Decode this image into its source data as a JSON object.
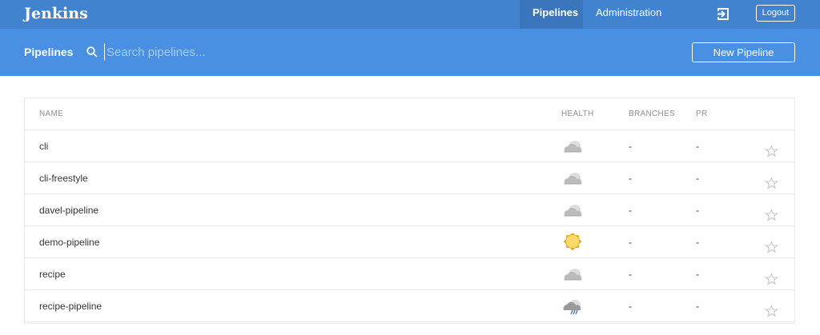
{
  "topbar": {
    "logo": "Jenkins",
    "nav": [
      {
        "label": "Pipelines",
        "active": true
      },
      {
        "label": "Administration",
        "active": false
      }
    ],
    "login_icon": "sign-in-icon",
    "logout_label": "Logout"
  },
  "subheader": {
    "title": "Pipelines",
    "search_placeholder": "Search pipelines...",
    "new_pipeline_label": "New Pipeline"
  },
  "table": {
    "headers": {
      "name": "NAME",
      "health": "HEALTH",
      "branches": "BRANCHES",
      "pr": "PR"
    },
    "rows": [
      {
        "name": "cli",
        "health": "cloudy",
        "branches": "-",
        "pr": "-"
      },
      {
        "name": "cli-freestyle",
        "health": "cloudy",
        "branches": "-",
        "pr": "-"
      },
      {
        "name": "davel-pipeline",
        "health": "cloudy",
        "branches": "-",
        "pr": "-"
      },
      {
        "name": "demo-pipeline",
        "health": "sunny",
        "branches": "-",
        "pr": "-"
      },
      {
        "name": "recipe",
        "health": "cloudy",
        "branches": "-",
        "pr": "-"
      },
      {
        "name": "recipe-pipeline",
        "health": "rainy",
        "branches": "-",
        "pr": "-"
      }
    ]
  },
  "colors": {
    "topbar": "#4283cf",
    "subheader": "#4a90e2"
  }
}
